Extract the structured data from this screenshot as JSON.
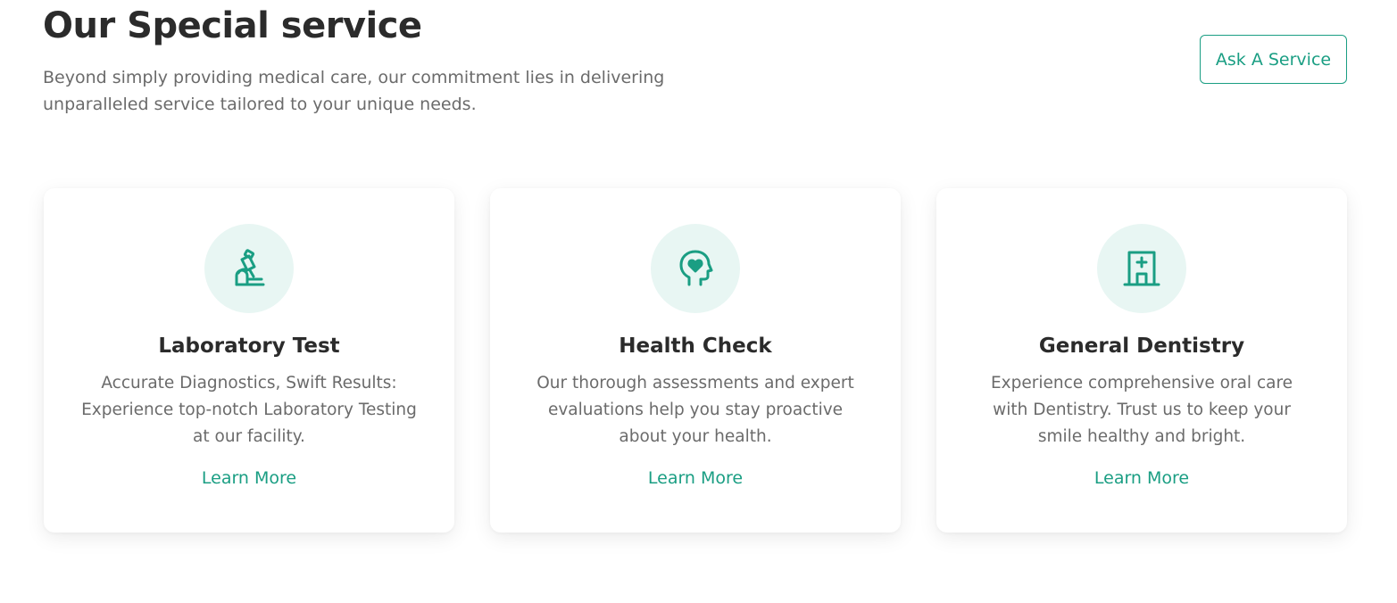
{
  "header": {
    "title": "Our Special service",
    "description": "Beyond simply providing medical care, our commitment lies in delivering unparalleled service tailored to your unique needs.",
    "cta_label": "Ask A Service"
  },
  "colors": {
    "accent": "#1a9e83",
    "icon_bg": "#e8f6f3",
    "title_text": "#2b2b2b",
    "body_text": "#6b6b6b"
  },
  "cards": [
    {
      "icon": "microscope-icon",
      "title": "Laboratory Test",
      "description": "Accurate Diagnostics, Swift Results: Experience top-notch Laboratory Testing at our facility.",
      "link_label": "Learn More"
    },
    {
      "icon": "head-heart-icon",
      "title": "Health Check",
      "description": "Our thorough assessments and expert evaluations help you stay proactive about your health.",
      "link_label": "Learn More"
    },
    {
      "icon": "hospital-icon",
      "title": "General Dentistry",
      "description": "Experience comprehensive oral care with Dentistry. Trust us to keep your smile healthy and bright.",
      "link_label": "Learn More"
    }
  ]
}
